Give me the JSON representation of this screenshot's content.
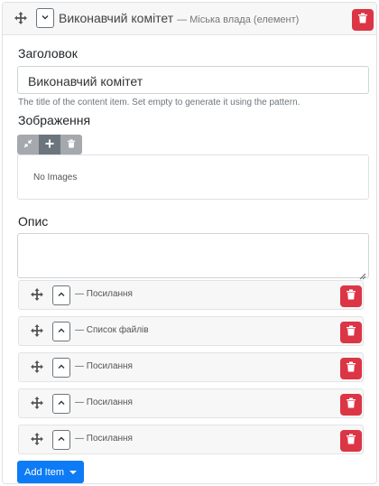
{
  "header": {
    "title": "Виконавчий комітет",
    "subtitle": "— Міська влада (елемент)"
  },
  "fields": {
    "title_label": "Заголовок",
    "title_value": "Виконавчий комітет",
    "title_help": "The title of the content item. Set empty to generate it using the pattern.",
    "images_label": "Зображення",
    "no_images": "No Images",
    "description_label": "Опис",
    "description_value": ""
  },
  "items": [
    {
      "title": "— Посилання"
    },
    {
      "title": "— Список файлів"
    },
    {
      "title": "— Посилання"
    },
    {
      "title": "— Посилання"
    },
    {
      "title": "— Посилання"
    }
  ],
  "add_item_label": "Add Item",
  "colors": {
    "danger": "#dc3545",
    "primary": "#0d7bf5",
    "secondary": "#6c757d"
  },
  "icons": {
    "move": "arrows-move-icon",
    "toggle_header": "chevron-down-icon",
    "toggle_item": "chevron-up-icon",
    "delete": "trash-icon",
    "collapse": "compress-icon",
    "add": "plus-icon"
  }
}
